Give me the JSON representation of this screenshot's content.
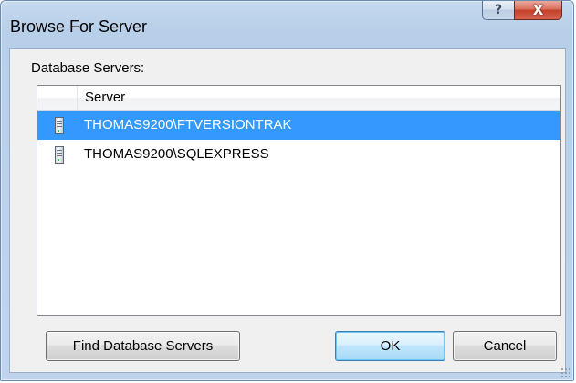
{
  "window": {
    "title": "Browse For Server",
    "help_glyph": "?",
    "close_glyph": "X"
  },
  "list": {
    "group_label": "Database Servers:",
    "column_header": "Server",
    "rows": [
      {
        "name": "THOMAS9200\\FTVERSIONTRAK",
        "selected": true,
        "icon": "server-icon"
      },
      {
        "name": "THOMAS9200\\SQLEXPRESS",
        "selected": false,
        "icon": "server-icon"
      }
    ]
  },
  "buttons": {
    "find": "Find Database Servers",
    "ok": "OK",
    "cancel": "Cancel"
  },
  "colors": {
    "selection": "#3399ff",
    "titlebar": "#bfd4ec",
    "close": "#c4402a"
  }
}
